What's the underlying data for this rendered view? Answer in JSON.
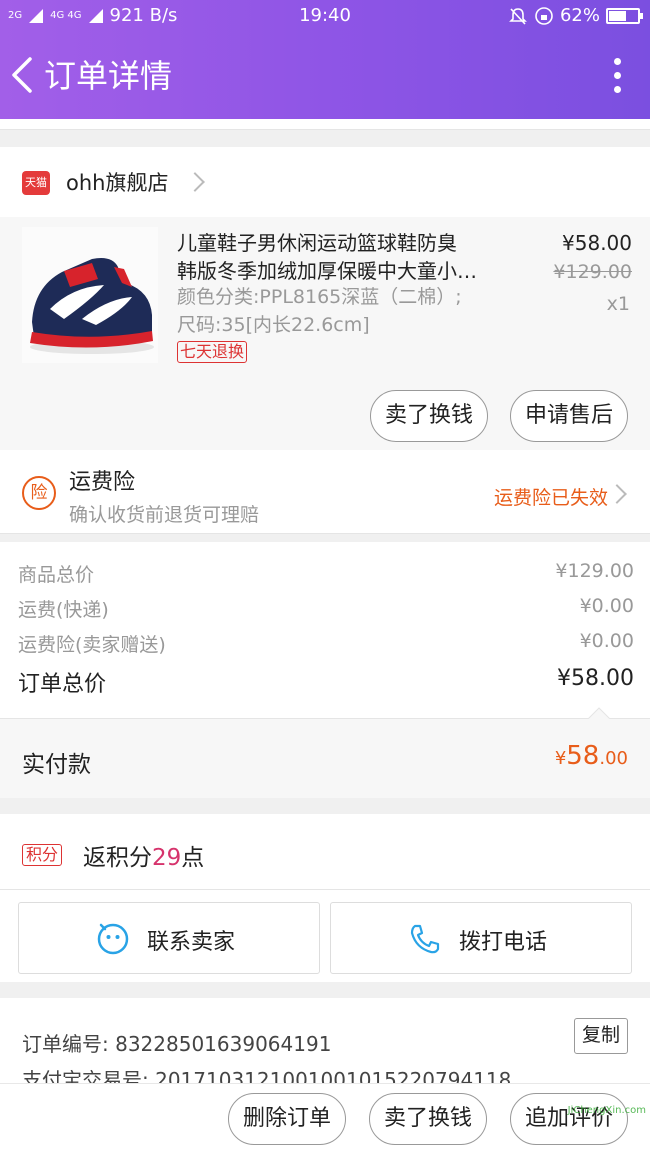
{
  "status_bar": {
    "network_1": "2G",
    "network_2": "4G 4G",
    "speed": "921 B/s",
    "time": "19:40",
    "battery": "62%",
    "battery_level": 0.62
  },
  "header": {
    "title": "订单详情"
  },
  "store": {
    "badge": "天猫",
    "name": "ohh旗舰店"
  },
  "product": {
    "name_line1": "儿童鞋子男休闲运动篮球鞋防臭",
    "name_line2": "韩版冬季加绒加厚保暖中大童小…",
    "spec_line1": "颜色分类:PPL8165深蓝（二棉）;",
    "spec_line2": "尺码:35[内长22.6cm]",
    "tag": "七天退换",
    "price": "¥58.00",
    "original_price": "¥129.00",
    "quantity": "x1",
    "btn_sell": "卖了换钱",
    "btn_after_sale": "申请售后"
  },
  "insurance": {
    "icon_text": "险",
    "title": "运费险",
    "subtitle": "确认收货前退货可理赔",
    "status": "运费险已失效"
  },
  "summary": {
    "goods_total_label": "商品总价",
    "goods_total": "¥129.00",
    "shipping_label": "运费(快递)",
    "shipping": "¥0.00",
    "insurance_label": "运费险(卖家赠送)",
    "insurance": "¥0.00",
    "order_total_label": "订单总价",
    "order_total": "¥58.00"
  },
  "paid": {
    "label": "实付款",
    "currency": "¥",
    "int": "58",
    "dec": ".00"
  },
  "points": {
    "tag": "积分",
    "prefix": "返积分",
    "value": "29",
    "suffix": "点"
  },
  "contact": {
    "seller": "联系卖家",
    "phone": "拨打电话"
  },
  "order_info": {
    "order_no": "订单编号: 83228501639064191",
    "copy": "复制",
    "alipay_no": "支付宝交易号: 2017103121001001015220794118"
  },
  "bottom": {
    "delete": "删除订单",
    "sell": "卖了换钱",
    "review": "追加评价"
  },
  "watermark": "JiChengXin.com",
  "colors": {
    "header": "#8f55e6",
    "accent": "#e85d1a",
    "tag_red": "#dd3333"
  }
}
